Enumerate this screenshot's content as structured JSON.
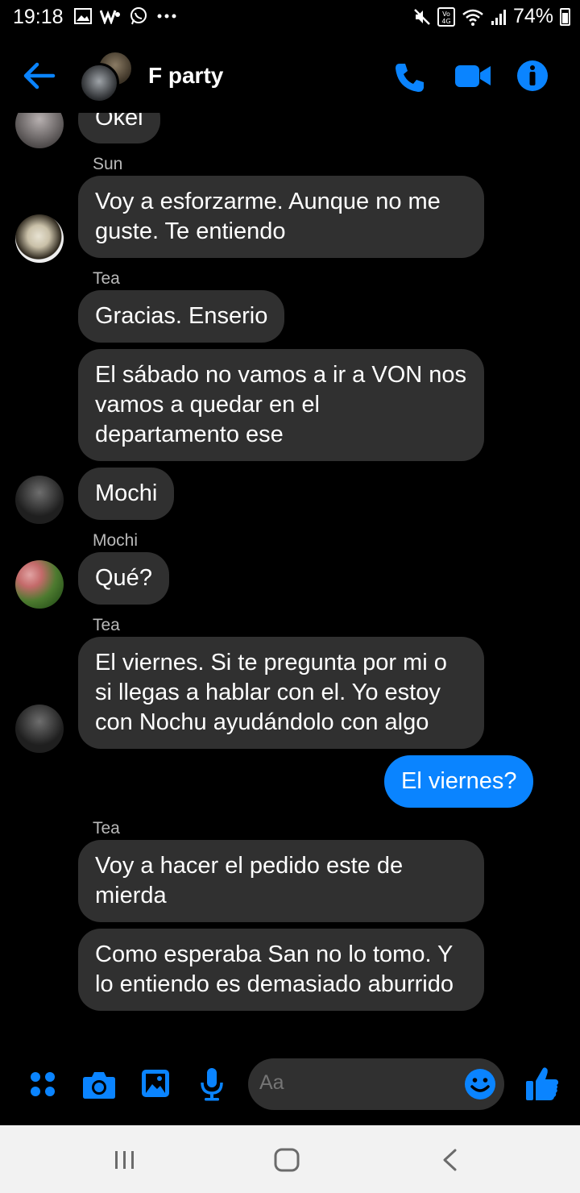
{
  "status_bar": {
    "time": "19:18",
    "battery": "74%",
    "left_icons": [
      "gallery-icon",
      "w-app-icon",
      "whatsapp-icon",
      "more-dots-icon"
    ],
    "right_icons": [
      "mute-icon",
      "volte-4g-icon",
      "wifi-icon",
      "signal-icon",
      "battery-icon"
    ]
  },
  "header": {
    "title": "F party",
    "icons": [
      "back-arrow-icon",
      "phone-icon",
      "video-icon",
      "info-icon"
    ],
    "accent": "#0a84ff"
  },
  "messages": [
    {
      "text": "Okei",
      "from": "other"
    },
    {
      "sender": "Sun"
    },
    {
      "text": "Voy a esforzarme. Aunque no me guste. Te entiendo",
      "from": "other"
    },
    {
      "sender": "Tea"
    },
    {
      "text": "Gracias. Enserio",
      "from": "other"
    },
    {
      "text": "El sábado no vamos a ir a VON nos vamos a quedar en el departamento ese",
      "from": "other"
    },
    {
      "text": "Mochi",
      "from": "other"
    },
    {
      "sender": "Mochi"
    },
    {
      "text": "Qué?",
      "from": "other"
    },
    {
      "sender": "Tea"
    },
    {
      "text": "El viernes. Si te pregunta por mi o si llegas a hablar con el. Yo estoy con Nochu ayudándolo con algo",
      "from": "other"
    },
    {
      "text": "El viernes?",
      "from": "me"
    },
    {
      "sender": "Tea"
    },
    {
      "text": "Voy a hacer el pedido este de mierda",
      "from": "other"
    },
    {
      "text": "Como esperaba San no lo tomo. Y lo entiendo es demasiado aburrido",
      "from": "other"
    }
  ],
  "composer": {
    "placeholder": "Aa",
    "icons": [
      "apps-icon",
      "camera-icon",
      "image-icon",
      "microphone-icon",
      "emoji-icon",
      "thumbs-up-icon"
    ]
  },
  "nav_bar": {
    "icons": [
      "recents-icon",
      "home-icon",
      "back-icon"
    ]
  }
}
